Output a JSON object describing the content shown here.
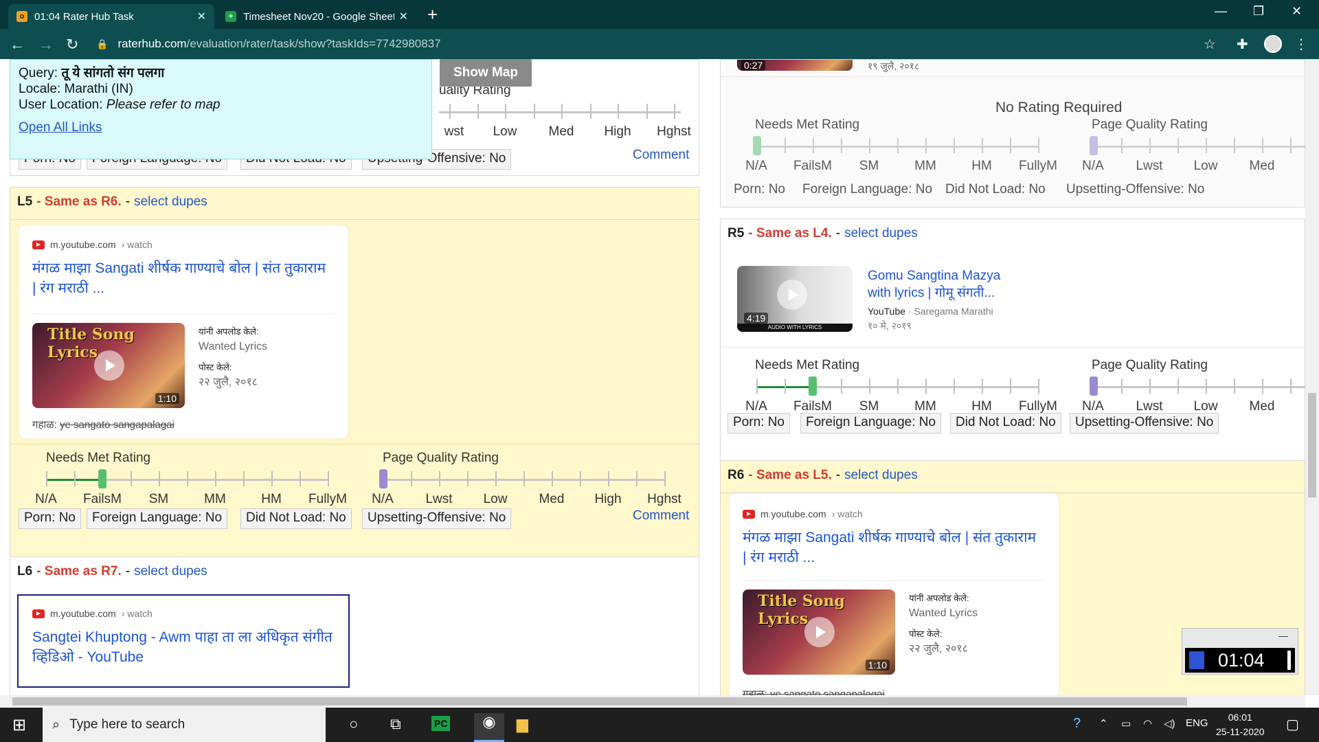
{
  "browser": {
    "tabs": [
      {
        "label": "01:04 Rater Hub Task",
        "active": true,
        "favicon": "raterhub-icon"
      },
      {
        "label": "Timesheet Nov20 - Google Sheet",
        "active": false,
        "favicon": "sheets-icon"
      }
    ],
    "url_host": "raterhub.com",
    "url_path": "/evaluation/rater/task/show?taskIds=7742980837"
  },
  "query_box": {
    "query_label": "Query:",
    "query_value": "तू ये सांगतो संग पलगा",
    "locale": "Locale: Marathi (IN)",
    "user_location_label": "User Location:",
    "user_location_value": "Please refer to map",
    "open_all_links": "Open All Links",
    "show_map": "Show Map"
  },
  "rating_labels": {
    "needs_met_title": "Needs Met Rating",
    "page_quality_title": "Page Quality Rating",
    "nm": [
      "N/A",
      "FailsM",
      "SM",
      "MM",
      "HM",
      "FullyM"
    ],
    "pq": [
      "N/A",
      "Lwst",
      "Low",
      "Med",
      "High",
      "Hghst"
    ],
    "pq_partial_top": "uality Rating",
    "pq_partial_wst": "wst",
    "comment": "Comment",
    "no_rating_required": "No Rating Required",
    "flags": [
      "Porn: No",
      "Foreign Language: No",
      "Did Not Load: No",
      "Upsetting-Offensive: No"
    ]
  },
  "left": {
    "L5": {
      "id": "L5",
      "same": "- Same as R6.",
      "sep": "-",
      "dupes": "select dupes",
      "source": "m.youtube.com",
      "crumb": "› watch",
      "title": "मंगळ माझा Sangati शीर्षक गाण्याचे बोल | संत तुकाराम | रंग मराठी ...",
      "thumb_text_a": "Title Song",
      "thumb_text_b": "Lyrics",
      "duration": "1:10",
      "uploaded_by_label": "यांनी अपलोड केले:",
      "uploaded_by": "Wanted Lyrics",
      "posted_label": "पोस्ट केले:",
      "posted": "२२ जुलै, २०१८",
      "missing_label": "गहाळ:",
      "missing": "ye sangato sangapalagai"
    },
    "L6": {
      "id": "L6",
      "same": "- Same as R7.",
      "sep": "-",
      "dupes": "select dupes",
      "source": "m.youtube.com",
      "crumb": "› watch",
      "title": "Sangtei Khuptong - Awm पाहा ता ला अधिकृत संगीत व्हिडिओ - YouTube"
    }
  },
  "right": {
    "top_date": "१९ जुलै, २०१८",
    "top_duration": "0:27",
    "R5": {
      "id": "R5",
      "same": "- Same as L4.",
      "sep": "-",
      "dupes": "select dupes",
      "title": "Gomu Sangtina Mazya with lyrics | गोमू संगती...",
      "channel": "YouTube",
      "channel_sub": "· Saregama Marathi",
      "date": "१० मे, २०१९",
      "duration": "4:19",
      "thumb_caption": "AUDIO WITH LYRICS"
    },
    "R6": {
      "id": "R6",
      "same": "- Same as L5.",
      "sep": "-",
      "dupes": "select dupes",
      "source": "m.youtube.com",
      "crumb": "› watch",
      "title": "मंगळ माझा Sangati शीर्षक गाण्याचे बोल | संत तुकाराम | रंग मराठी ...",
      "thumb_text_a": "Title Song",
      "thumb_text_b": "Lyrics",
      "duration": "1:10",
      "uploaded_by_label": "यांनी अपलोड केले:",
      "uploaded_by": "Wanted Lyrics",
      "posted_label": "पोस्ट केले:",
      "posted": "२२ जुलै, २०१८",
      "missing_cut": "गहाळ: ye sangato sangapalagai"
    }
  },
  "ratings": {
    "L5": {
      "needs_met": "FailsM",
      "page_quality": "N/A"
    },
    "R_top": {
      "needs_met": "N/A",
      "page_quality": "N/A"
    },
    "R5": {
      "needs_met": "FailsM",
      "page_quality": "N/A"
    }
  },
  "timer": {
    "value": "01:04",
    "minimize": "—"
  },
  "taskbar": {
    "search_placeholder": "Type here to search",
    "lang": "ENG",
    "time": "06:01",
    "date": "25-11-2020"
  },
  "colors": {
    "header_yellow": "#fff8cc",
    "link_blue": "#2156c6",
    "same_red": "#d43b2f",
    "needs_met_green": "#1f8a3a",
    "pq_purple": "#8b7bc8"
  }
}
